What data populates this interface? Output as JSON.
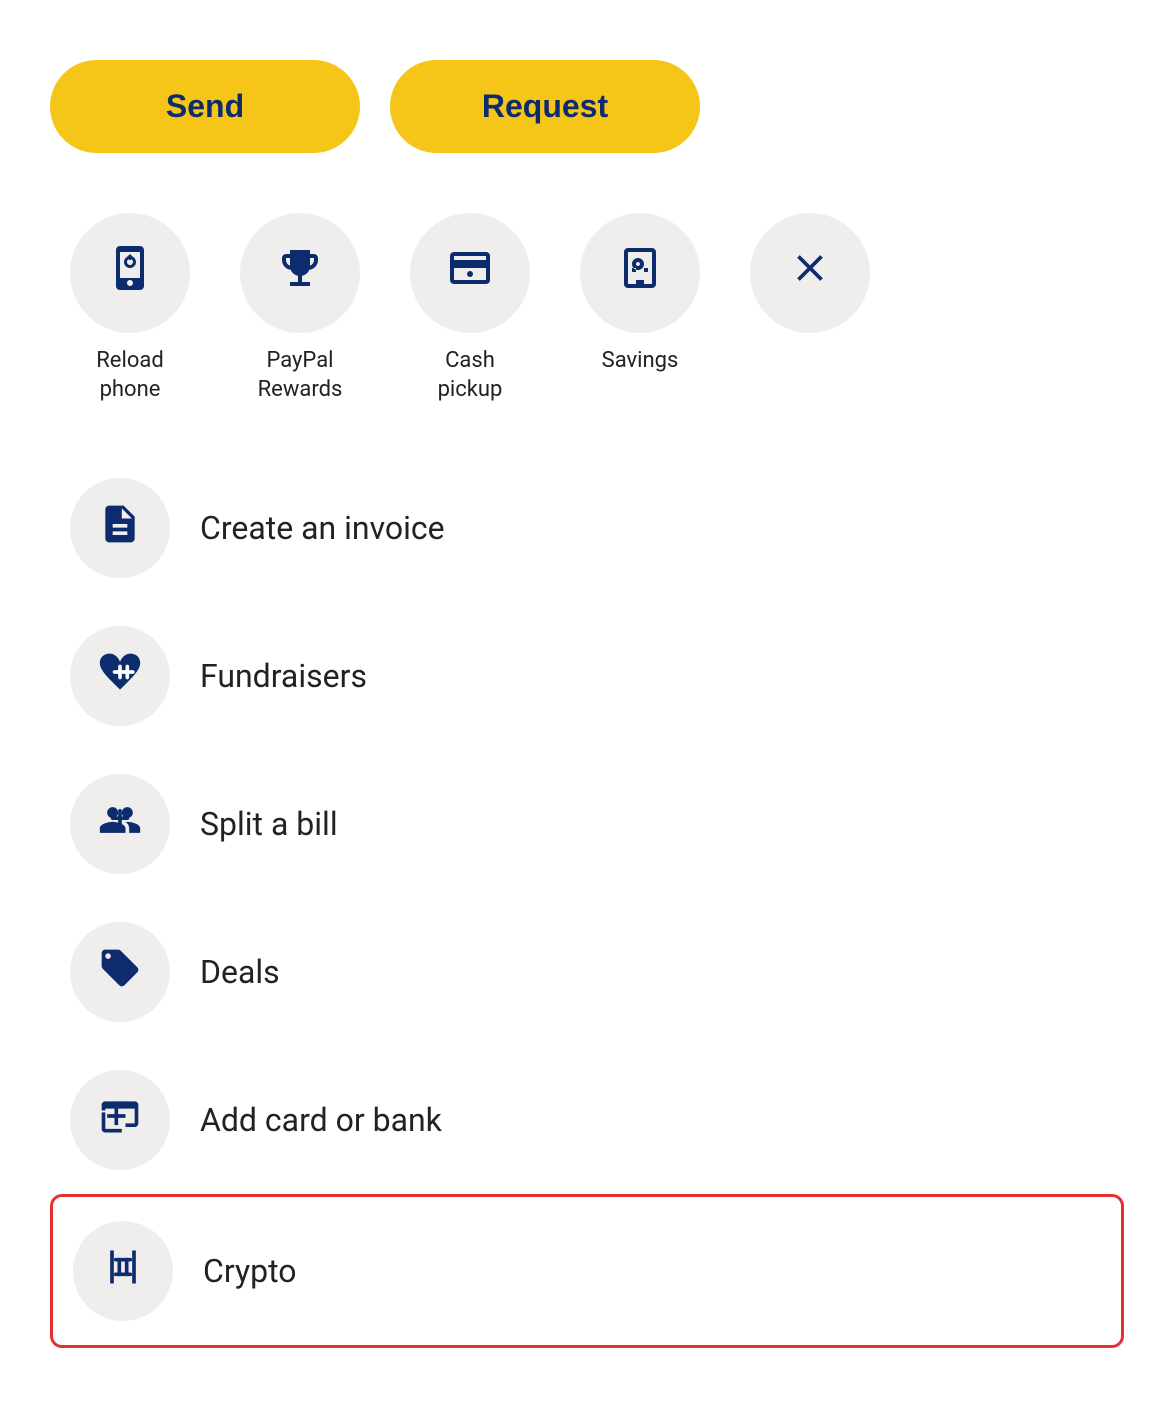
{
  "buttons": {
    "send_label": "Send",
    "request_label": "Request"
  },
  "quick_actions": [
    {
      "id": "reload-phone",
      "label": "Reload\nphone",
      "icon": "phone-reload"
    },
    {
      "id": "paypal-rewards",
      "label": "PayPal\nRewards",
      "icon": "trophy"
    },
    {
      "id": "cash-pickup",
      "label": "Cash\npickup",
      "icon": "cash"
    },
    {
      "id": "savings",
      "label": "Savings",
      "icon": "safe"
    },
    {
      "id": "close",
      "label": "",
      "icon": "close"
    }
  ],
  "list_items": [
    {
      "id": "create-invoice",
      "label": "Create an invoice",
      "icon": "invoice",
      "highlighted": false
    },
    {
      "id": "fundraisers",
      "label": "Fundraisers",
      "icon": "fundraiser",
      "highlighted": false
    },
    {
      "id": "split-bill",
      "label": "Split a bill",
      "icon": "split-bill",
      "highlighted": false
    },
    {
      "id": "deals",
      "label": "Deals",
      "icon": "tag",
      "highlighted": false
    },
    {
      "id": "add-card-bank",
      "label": "Add card or bank",
      "icon": "add-bank",
      "highlighted": false
    },
    {
      "id": "crypto",
      "label": "Crypto",
      "icon": "crypto",
      "highlighted": true
    }
  ]
}
